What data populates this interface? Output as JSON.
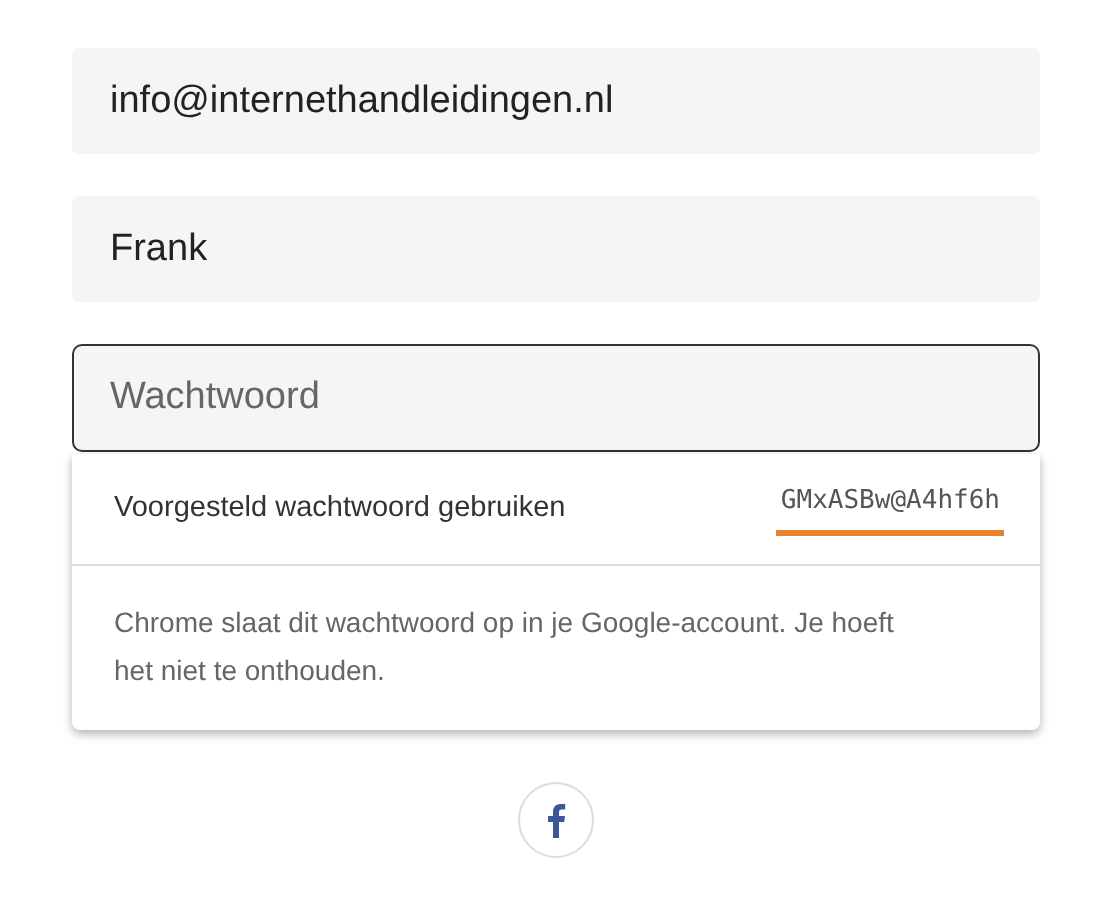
{
  "fields": [
    {
      "kind": "value",
      "value": "info@internethandleidingen.nl",
      "focused": false
    },
    {
      "kind": "value",
      "value": "Frank",
      "focused": false
    },
    {
      "kind": "placeholder",
      "placeholder": "Wachtwoord",
      "focused": true
    }
  ],
  "suggestion": {
    "label": "Voorgesteld wachtwoord gebruiken",
    "password": "GMxASBw@A4hf6h",
    "note": "Chrome slaat dit wachtwoord op in je Google-account. Je hoeft het niet te onthouden."
  }
}
